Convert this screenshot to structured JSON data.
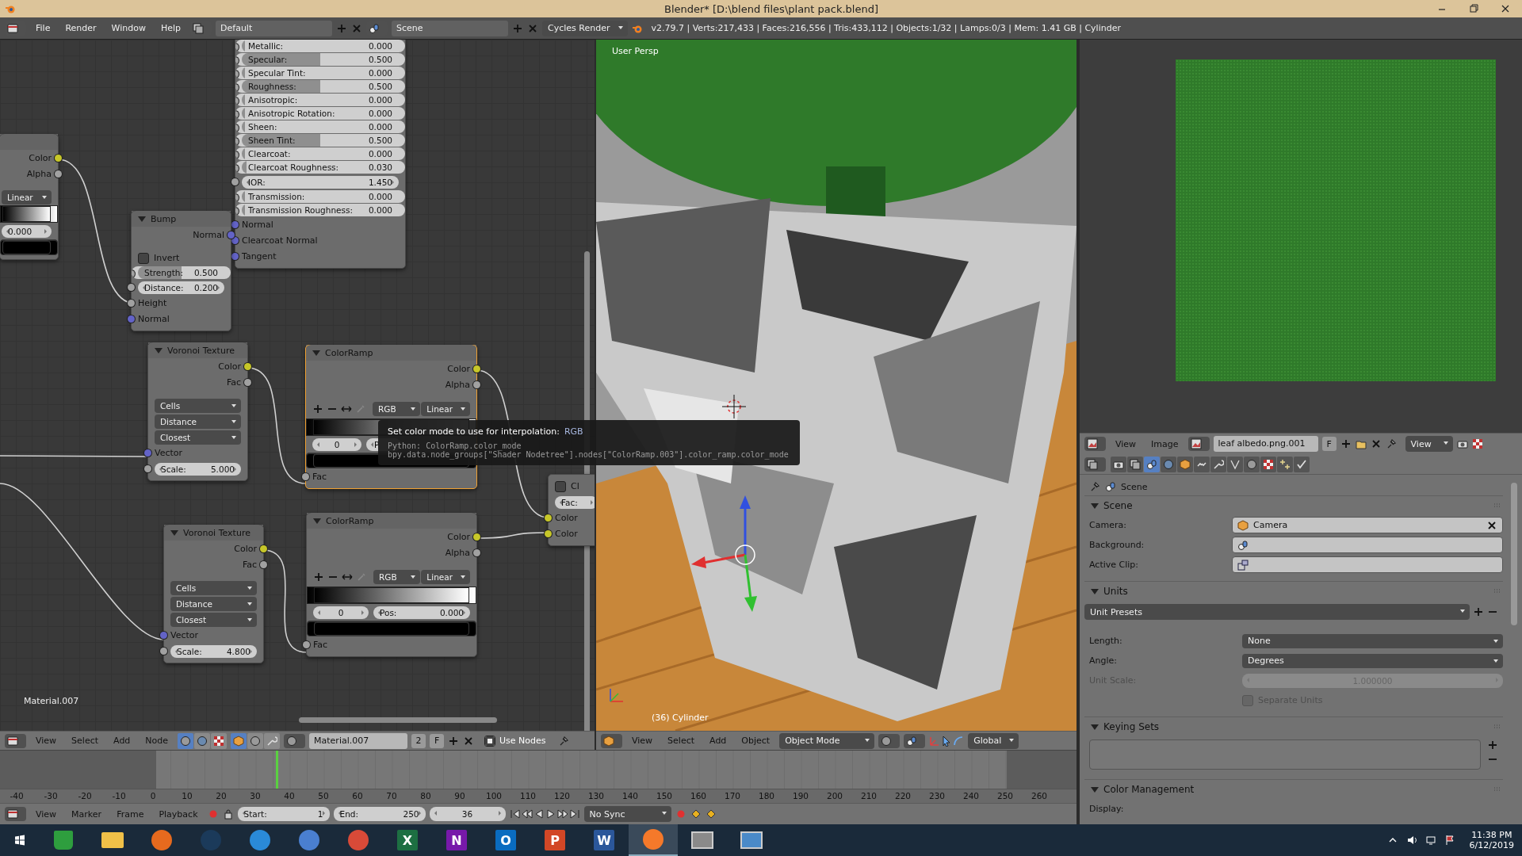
{
  "window": {
    "title": "Blender* [D:\\blend files\\plant pack.blend]"
  },
  "info_header": {
    "menus": [
      "File",
      "Render",
      "Window",
      "Help"
    ],
    "screen_layout": "Default",
    "scene": "Scene",
    "render_engine": "Cycles Render",
    "stats": "v2.79.7 | Verts:217,433 | Faces:216,556 | Tris:433,112 | Objects:1/32 | Lamps:0/3 | Mem: 1.41 GB | Cylinder"
  },
  "node_editor": {
    "nodes": [
      {
        "selected": false,
        "rows": [
          {
            "kind": "output",
            "label": "Color",
            "color": "#c7c729"
          },
          {
            "kind": "output",
            "label": "Alpha",
            "color": "#a1a1a1"
          },
          {
            "kind": "spacer"
          },
          {
            "kind": "dropdown",
            "value": "Linear"
          },
          {
            "kind": "ramp"
          },
          {
            "kind": "number",
            "value": "0.000"
          },
          {
            "kind": "swatch"
          }
        ]
      },
      {
        "selected": false,
        "rows": [
          {
            "kind": "slider",
            "label": "Metallic:",
            "value": "0.000",
            "level": 0,
            "color": "#a1a1a1"
          },
          {
            "kind": "slider",
            "label": "Specular:",
            "value": "0.500",
            "level": 0.5,
            "color": "#a1a1a1"
          },
          {
            "kind": "slider",
            "label": "Specular Tint:",
            "value": "0.000",
            "level": 0,
            "color": "#a1a1a1"
          },
          {
            "kind": "slider",
            "label": "Roughness:",
            "value": "0.500",
            "level": 0.5,
            "color": "#a1a1a1"
          },
          {
            "kind": "slider",
            "label": "Anisotropic:",
            "value": "0.000",
            "level": 0,
            "color": "#a1a1a1"
          },
          {
            "kind": "slider",
            "label": "Anisotropic Rotation:",
            "value": "0.000",
            "level": 0,
            "color": "#a1a1a1"
          },
          {
            "kind": "slider",
            "label": "Sheen:",
            "value": "0.000",
            "level": 0,
            "color": "#a1a1a1"
          },
          {
            "kind": "slider",
            "label": "Sheen Tint:",
            "value": "0.500",
            "level": 0.5,
            "color": "#a1a1a1"
          },
          {
            "kind": "slider",
            "label": "Clearcoat:",
            "value": "0.000",
            "level": 0,
            "color": "#a1a1a1"
          },
          {
            "kind": "slider",
            "label": "Clearcoat Roughness:",
            "value": "0.030",
            "level": 0.03,
            "color": "#a1a1a1"
          },
          {
            "kind": "number",
            "label": "IOR:",
            "value": "1.450",
            "color": "#a1a1a1"
          },
          {
            "kind": "slider",
            "label": "Transmission:",
            "value": "0.000",
            "level": 0,
            "color": "#a1a1a1"
          },
          {
            "kind": "slider",
            "label": "Transmission Roughness:",
            "value": "0.000",
            "level": 0,
            "color": "#a1a1a1"
          },
          {
            "kind": "input",
            "label": "Normal",
            "color": "#6363c7"
          },
          {
            "kind": "input",
            "label": "Clearcoat Normal",
            "color": "#6363c7"
          },
          {
            "kind": "input",
            "label": "Tangent",
            "color": "#6363c7"
          }
        ]
      },
      {
        "title": "Bump",
        "selected": false,
        "rows": [
          {
            "kind": "output",
            "label": "Normal",
            "color": "#6363c7"
          },
          {
            "kind": "spacer"
          },
          {
            "kind": "checkbox",
            "label": "Invert",
            "checked": false
          },
          {
            "kind": "slider",
            "label": "Strength:",
            "value": "0.500",
            "level": 0.5,
            "color": "#a1a1a1"
          },
          {
            "kind": "number",
            "label": "Distance:",
            "value": "0.200",
            "color": "#a1a1a1"
          },
          {
            "kind": "input",
            "label": "Height",
            "color": "#a1a1a1"
          },
          {
            "kind": "input",
            "label": "Normal",
            "color": "#6363c7"
          }
        ]
      },
      {
        "title": "Voronoi Texture",
        "selected": false,
        "rows": [
          {
            "kind": "output",
            "label": "Color",
            "color": "#c7c729"
          },
          {
            "kind": "output",
            "label": "Fac",
            "color": "#a1a1a1"
          },
          {
            "kind": "spacer"
          },
          {
            "kind": "dropdown",
            "value": "Cells"
          },
          {
            "kind": "dropdown",
            "value": "Distance"
          },
          {
            "kind": "dropdown",
            "value": "Closest"
          },
          {
            "kind": "input",
            "label": "Vector",
            "color": "#6363c7"
          },
          {
            "kind": "number",
            "label": "Scale:",
            "value": "5.000",
            "color": "#a1a1a1"
          }
        ]
      },
      {
        "title": "ColorRamp",
        "selected": true,
        "rows": [
          {
            "kind": "output",
            "label": "Color",
            "color": "#c7c729"
          },
          {
            "kind": "output",
            "label": "Alpha",
            "color": "#a1a1a1"
          },
          {
            "kind": "spacer"
          },
          {
            "kind": "ramp_controls",
            "mode": "RGB",
            "interpolation": "Linear"
          },
          {
            "kind": "ramp"
          },
          {
            "kind": "ramp_fields",
            "index": "0",
            "pos_label": "P"
          },
          {
            "kind": "swatch"
          },
          {
            "kind": "input",
            "label": "Fac",
            "color": "#a1a1a1"
          }
        ]
      },
      {
        "title": "Voronoi Texture",
        "selected": false,
        "rows": [
          {
            "kind": "output",
            "label": "Color",
            "color": "#c7c729"
          },
          {
            "kind": "output",
            "label": "Fac",
            "color": "#a1a1a1"
          },
          {
            "kind": "spacer"
          },
          {
            "kind": "dropdown",
            "value": "Cells"
          },
          {
            "kind": "dropdown",
            "value": "Distance"
          },
          {
            "kind": "dropdown",
            "value": "Closest"
          },
          {
            "kind": "input",
            "label": "Vector",
            "color": "#6363c7"
          },
          {
            "kind": "number",
            "label": "Scale:",
            "value": "4.800",
            "color": "#a1a1a1"
          }
        ]
      },
      {
        "title": "ColorRamp",
        "selected": false,
        "rows": [
          {
            "kind": "output",
            "label": "Color",
            "color": "#c7c729"
          },
          {
            "kind": "output",
            "label": "Alpha",
            "color": "#a1a1a1"
          },
          {
            "kind": "spacer"
          },
          {
            "kind": "ramp_controls",
            "mode": "RGB",
            "interpolation": "Linear"
          },
          {
            "kind": "ramp"
          },
          {
            "kind": "ramp_fields",
            "index": "0",
            "pos_label": "Pos:",
            "pos_value": "0.000"
          },
          {
            "kind": "swatch"
          },
          {
            "kind": "input",
            "label": "Fac",
            "color": "#a1a1a1"
          }
        ]
      },
      {
        "selected": false,
        "rows": [
          {
            "kind": "checkbox",
            "label": "Cl",
            "checked": false
          },
          {
            "kind": "number",
            "label": "Fac:"
          },
          {
            "kind": "input",
            "label": "Color",
            "color": "#c7c729"
          },
          {
            "kind": "input",
            "label": "Color",
            "color": "#c7c729"
          }
        ]
      }
    ],
    "material_label": "Material.007",
    "tooltip": {
      "text": "Set color mode to use for interpolation:",
      "value": "RGB",
      "python": [
        "Python: ColorRamp.color_mode",
        "bpy.data.node_groups[\"Shader Nodetree\"].nodes[\"ColorRamp.003\"].color_ramp.color_mode"
      ]
    }
  },
  "node_header": {
    "menus": [
      "View",
      "Select",
      "Add",
      "Node"
    ],
    "shader_types": [
      {
        "selected": true
      },
      {
        "selected": false
      },
      {
        "selected": false
      }
    ],
    "shader_sources": [
      {
        "selected": true
      },
      {
        "selected": false
      },
      {
        "selected": false
      }
    ],
    "material": "Material.007",
    "users": "2",
    "fake_user": "F",
    "use_nodes": {
      "label": "Use Nodes",
      "checked": true
    }
  },
  "viewport": {
    "view_label": "User Persp",
    "object_label": "(36) Cylinder",
    "menus": [
      "View",
      "Select",
      "Add",
      "Object"
    ],
    "mode": "Object Mode",
    "orientation": "Global"
  },
  "image_editor": {
    "menus": [
      "View",
      "Image"
    ],
    "image": "leaf albedo.png.001",
    "fake_user": "F",
    "view": "View"
  },
  "properties": {
    "tabs": [
      {
        "selected": false
      },
      {
        "selected": false
      },
      {
        "selected": true
      },
      {
        "selected": false
      },
      {
        "selected": false
      },
      {
        "selected": false
      },
      {
        "selected": false
      },
      {
        "selected": false
      },
      {
        "selected": false
      },
      {
        "selected": false
      },
      {
        "selected": false
      },
      {
        "selected": false
      }
    ],
    "context": "Scene",
    "panels": [
      {
        "kind": "scene",
        "title": "Scene",
        "expanded": true,
        "fields": [
          {
            "label": "Camera:",
            "value": "Camera"
          },
          {
            "label": "Background:"
          },
          {
            "label": "Active Clip:"
          }
        ]
      },
      {
        "kind": "units",
        "title": "Units",
        "expanded": true,
        "preset": "Unit Presets",
        "fields": [
          {
            "label": "Length:",
            "value": "None"
          },
          {
            "label": "Angle:",
            "value": "Degrees"
          }
        ],
        "scale": {
          "label": "Unit Scale:",
          "value": "1.000000",
          "disabled": true
        },
        "separate": {
          "label": "Separate Units",
          "checked": false,
          "disabled": true
        }
      },
      {
        "kind": "keying",
        "title": "Keying Sets",
        "expanded": true
      },
      {
        "kind": "color",
        "title": "Color Management",
        "expanded": true,
        "fields": [
          {
            "label": "Display:"
          }
        ]
      }
    ]
  },
  "timeline": {
    "ruler": [
      "-40",
      "-30",
      "-20",
      "-10",
      "0",
      "10",
      "20",
      "30",
      "40",
      "50",
      "60",
      "70",
      "80",
      "90",
      "100",
      "110",
      "120",
      "130",
      "140",
      "150",
      "160",
      "170",
      "180",
      "190",
      "200",
      "210",
      "220",
      "230",
      "240",
      "250",
      "260"
    ],
    "playhead": {
      "level": 0.256
    }
  },
  "timeline_header": {
    "menus": [
      "View",
      "Marker",
      "Frame",
      "Playback"
    ],
    "start_label": "Start:",
    "start": "1",
    "end_label": "End:",
    "end": "250",
    "current": "36",
    "sync": "No Sync"
  },
  "taskbar": {
    "apps": [
      {
        "kind": "store",
        "color": "#2e9e3e",
        "selected": false
      },
      {
        "kind": "folder",
        "color": "#f0c048",
        "selected": false
      },
      {
        "kind": "circle",
        "color": "#e66a1e",
        "selected": false
      },
      {
        "kind": "circle",
        "color": "#1b3a5a",
        "selected": false
      },
      {
        "kind": "circle",
        "color": "#2a8ad8",
        "selected": false
      },
      {
        "kind": "circle",
        "color": "#4a7fd0",
        "selected": false
      },
      {
        "kind": "circle",
        "color": "#d84a38",
        "selected": false
      },
      {
        "kind": "tile",
        "letter": "X",
        "color": "#1d6f42",
        "selected": false
      },
      {
        "kind": "tile",
        "letter": "N",
        "color": "#7719aa",
        "selected": false
      },
      {
        "kind": "tile",
        "letter": "O",
        "color": "#0a6cc0",
        "selected": false
      },
      {
        "kind": "tile",
        "letter": "P",
        "color": "#d24726",
        "selected": false
      },
      {
        "kind": "tile",
        "letter": "W",
        "color": "#2b579a",
        "selected": false
      },
      {
        "kind": "circle",
        "color": "#f5792a",
        "selected": true
      },
      {
        "kind": "window",
        "color": "#8a8a8a",
        "selected": false
      },
      {
        "kind": "window",
        "color": "#4a8ac8",
        "selected": false
      }
    ],
    "time": "11:38 PM",
    "date": "6/12/2019"
  }
}
